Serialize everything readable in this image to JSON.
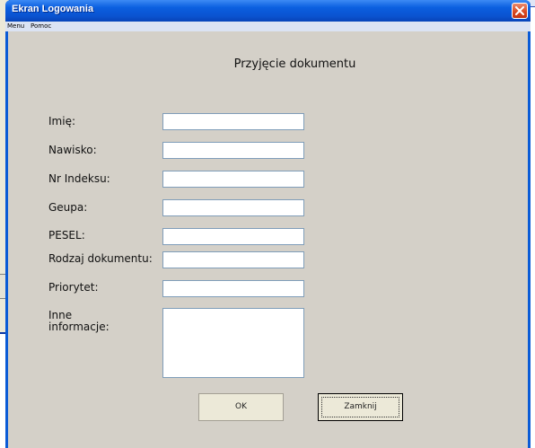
{
  "window": {
    "title": "Ekran Logowania"
  },
  "menu": {
    "items": [
      "Menu",
      "Pomoc"
    ]
  },
  "form": {
    "heading": "Przyjęcie dokumentu",
    "fields": [
      {
        "label": "Imię:",
        "value": ""
      },
      {
        "label": "Nawisko:",
        "value": ""
      },
      {
        "label": "Nr Indeksu:",
        "value": ""
      },
      {
        "label": "Geupa:",
        "value": ""
      },
      {
        "label": "PESEL:",
        "value": ""
      },
      {
        "label": "Rodzaj dokumentu:",
        "value": ""
      },
      {
        "label": "Priorytet:",
        "value": ""
      },
      {
        "label": "Inne informacje:",
        "value": ""
      }
    ]
  },
  "buttons": {
    "ok": "OK",
    "close": "Zamknij"
  },
  "colors": {
    "titlebar": "#0a5bd6",
    "client": "#d4d0c8",
    "menubar": "#dbe3f3",
    "close_button": "#d8471f"
  },
  "icons": {
    "close": "close-icon"
  }
}
